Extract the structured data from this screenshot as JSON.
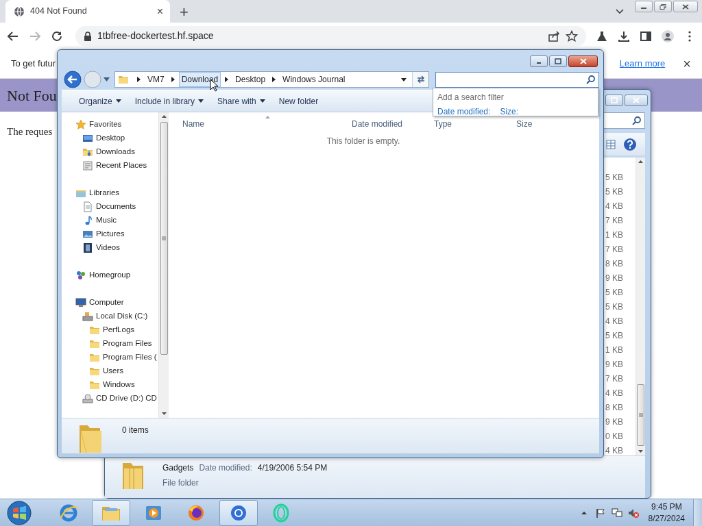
{
  "browser": {
    "tab": {
      "title": "404 Not Found",
      "close": "×"
    },
    "new_tab": "+",
    "address": "1tbfree-dockertest.hf.space",
    "infobar": {
      "text": "To get futur",
      "link": "Learn more",
      "close": "×"
    }
  },
  "page": {
    "heading": "Not Fou",
    "body": "The reques"
  },
  "back_window": {
    "sizes": [
      "5 KB",
      "5 KB",
      "4 KB",
      "7 KB",
      "1 KB",
      "7 KB",
      "8 KB",
      "9 KB",
      "5 KB",
      "5 KB",
      "4 KB",
      "5 KB",
      "1 KB",
      "9 KB",
      "7 KB",
      "4 KB",
      "8 KB",
      "9 KB",
      "0 KB",
      "4 KB"
    ],
    "details": {
      "name": "Gadgets",
      "date_label": "Date modified:",
      "date": "4/19/2006 5:54 PM",
      "type": "File folder"
    }
  },
  "explorer": {
    "breadcrumbs": [
      {
        "label": "VM7",
        "hovered": false
      },
      {
        "label": "Download",
        "hovered": true
      },
      {
        "label": "Desktop",
        "hovered": false
      },
      {
        "label": "Windows Journal",
        "hovered": false
      }
    ],
    "search_filter": {
      "title": "Add a search filter",
      "filters": [
        "Date modified:",
        "Size:"
      ]
    },
    "toolbar": [
      {
        "label": "Organize",
        "dropdown": true
      },
      {
        "label": "Include in library",
        "dropdown": true
      },
      {
        "label": "Share with",
        "dropdown": true
      },
      {
        "label": "New folder",
        "dropdown": false
      }
    ],
    "nav": [
      {
        "label": "Favorites",
        "kind": "star",
        "children": [
          {
            "label": "Desktop",
            "kind": "desktop"
          },
          {
            "label": "Downloads",
            "kind": "downloads"
          },
          {
            "label": "Recent Places",
            "kind": "recent"
          }
        ]
      },
      {
        "label": "Libraries",
        "kind": "library",
        "children": [
          {
            "label": "Documents",
            "kind": "document"
          },
          {
            "label": "Music",
            "kind": "music"
          },
          {
            "label": "Pictures",
            "kind": "pictures"
          },
          {
            "label": "Videos",
            "kind": "videos"
          }
        ]
      },
      {
        "label": "Homegroup",
        "kind": "homegroup"
      },
      {
        "label": "Computer",
        "kind": "computer",
        "children": [
          {
            "label": "Local Disk (C:)",
            "kind": "disk",
            "children": [
              {
                "label": "PerfLogs",
                "kind": "folder"
              },
              {
                "label": "Program Files",
                "kind": "folder"
              },
              {
                "label": "Program Files (",
                "kind": "folder"
              },
              {
                "label": "Users",
                "kind": "folder"
              },
              {
                "label": "Windows",
                "kind": "folder"
              }
            ]
          },
          {
            "label": "CD Drive (D:) CD",
            "kind": "cd"
          }
        ]
      }
    ],
    "columns": [
      "Name",
      "Date modified",
      "Type",
      "Size"
    ],
    "empty": "This folder is empty.",
    "status": "0 items"
  },
  "taskbar": {
    "apps": [
      {
        "kind": "ie",
        "selected": false
      },
      {
        "kind": "explorer",
        "selected": true
      },
      {
        "kind": "media",
        "selected": false
      },
      {
        "kind": "firefox",
        "selected": false
      },
      {
        "kind": "chrome",
        "selected": true
      },
      {
        "kind": "opera",
        "selected": false
      }
    ],
    "time": "9:45 PM",
    "date": "8/27/2024"
  }
}
